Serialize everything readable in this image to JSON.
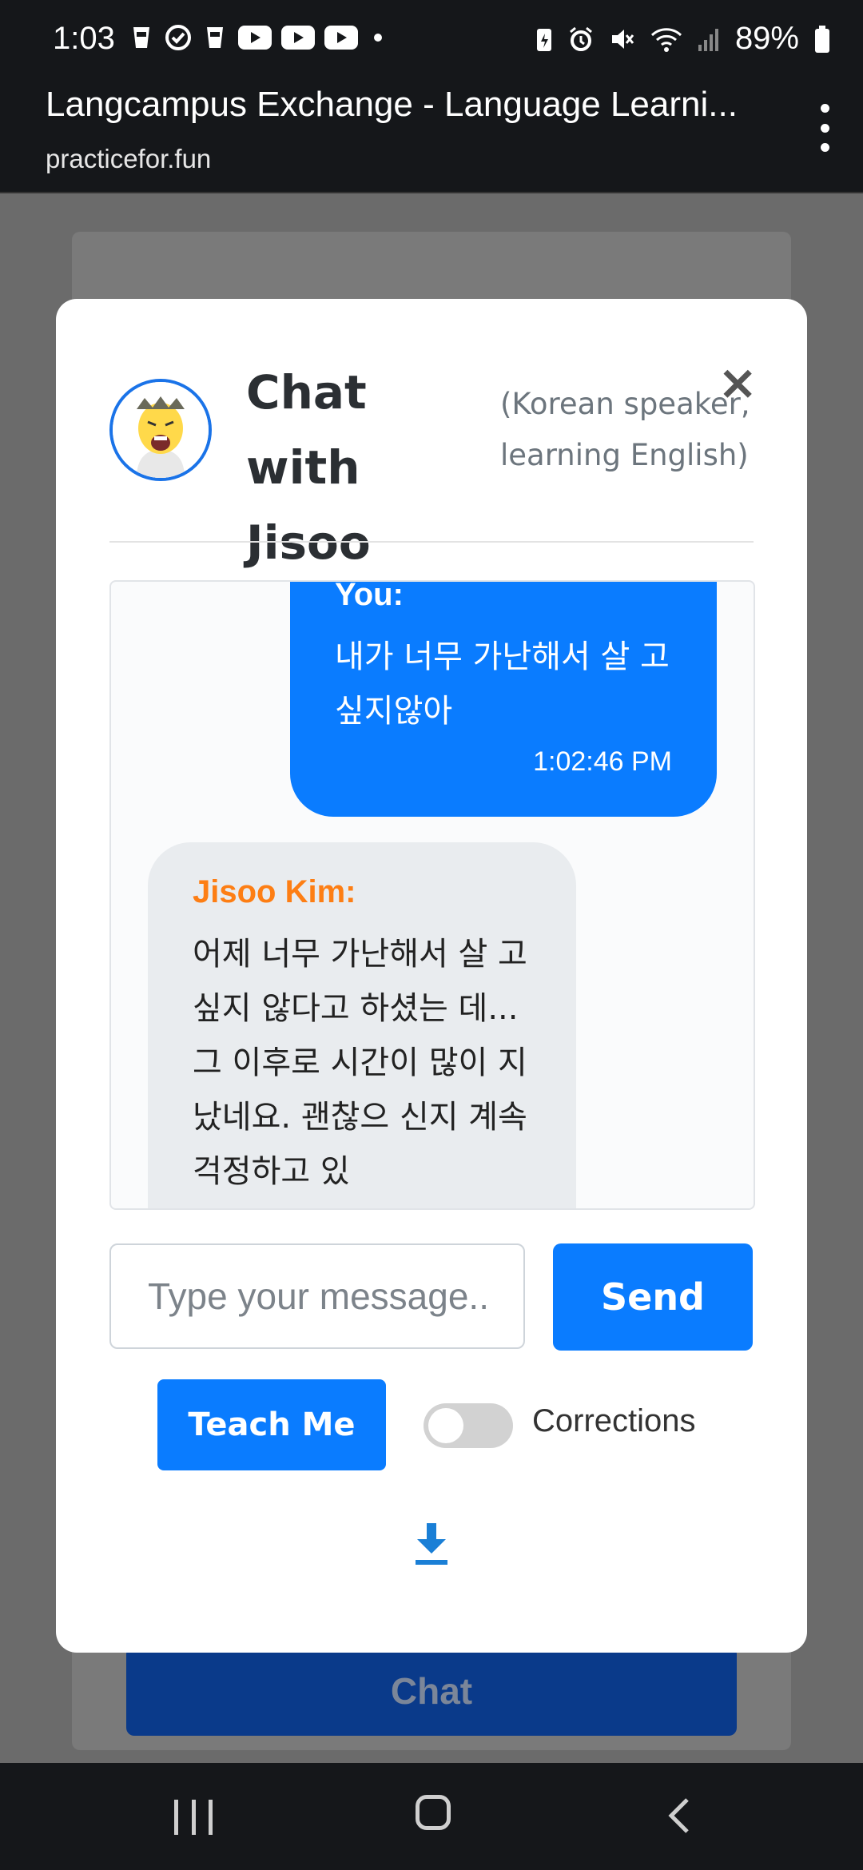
{
  "status_bar": {
    "time": "1:03",
    "battery": "89%"
  },
  "browser": {
    "title": "Langcampus Exchange - Language Learni...",
    "url": "practicefor.fun"
  },
  "background": {
    "chat_button_label": "Chat"
  },
  "modal": {
    "title": "Chat with Jisoo Kim",
    "subtitle": "(Korean speaker, learning English)",
    "close_label": "×"
  },
  "messages": [
    {
      "sender": "You:",
      "text": "내가 너무 가난해서 살 고싶지않아",
      "time": "1:02:46 PM"
    },
    {
      "sender": "Jisoo Kim:",
      "text": "어제 너무 가난해서 살 고 싶지 않다고 하셨는 데... 그 이후로 시간이 많이 지났네요. 괜찮으 신지 계속 걱정하고 있"
    }
  ],
  "input": {
    "placeholder": "Type your message..",
    "value": ""
  },
  "buttons": {
    "send": "Send",
    "teach_me": "Teach Me",
    "corrections_label": "Corrections"
  },
  "corrections_toggle": {
    "enabled": false
  },
  "icons": {
    "download": "download-icon",
    "close": "close-icon"
  },
  "colors": {
    "accent": "#0a7cff",
    "partner_name": "#fd7e14"
  }
}
